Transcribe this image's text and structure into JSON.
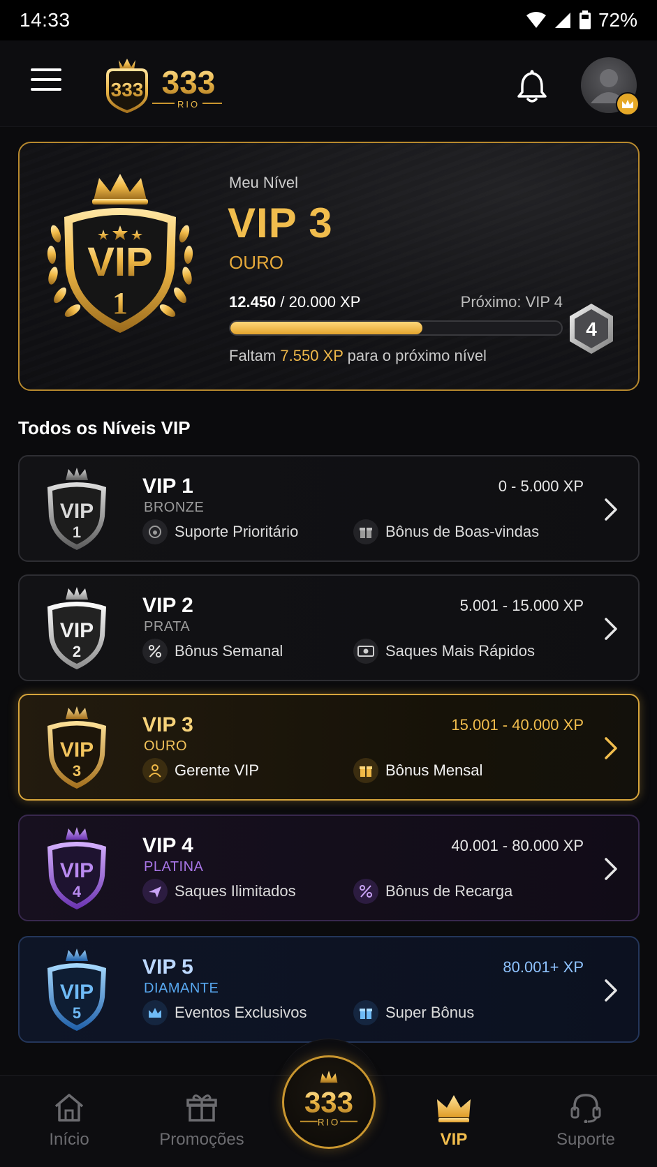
{
  "status": {
    "time": "14:33",
    "battery": "72%"
  },
  "header": {
    "logo_number": "333",
    "logo_sub": "RIO"
  },
  "my_level": {
    "heading": "Meu Nível",
    "level": "VIP 3",
    "tier": "OURO",
    "badge_text": "VIP",
    "badge_number": "1",
    "xp_current": "12.450",
    "xp_total": "/ 20.000 XP",
    "next_label": "Próximo: VIP 4",
    "next_number": "4",
    "progress_fraction": 0.58,
    "remaining_prefix": "Faltam",
    "remaining_value": "7.550 XP",
    "remaining_suffix": "para o próximo nível"
  },
  "section_title": "Todos os Níveis VIP",
  "tiers": [
    {
      "name": "VIP 1",
      "rank": "BRONZE",
      "range": "0 - 5.000 XP",
      "badge": "1",
      "perk1": "Suporte Prioritário",
      "perk2": "Bônus de Boas-vindas"
    },
    {
      "name": "VIP 2",
      "rank": "PRATA",
      "range": "5.001 - 15.000 XP",
      "badge": "2",
      "perk1": "Bônus Semanal",
      "perk2": "Saques Mais Rápidos"
    },
    {
      "name": "VIP 3",
      "rank": "OURO",
      "range": "15.001 - 40.000 XP",
      "badge": "3",
      "perk1": "Gerente VIP",
      "perk2": "Bônus Mensal"
    },
    {
      "name": "VIP 4",
      "rank": "PLATINA",
      "range": "40.001 - 80.000 XP",
      "badge": "4",
      "perk1": "Saques Ilimitados",
      "perk2": "Bônus de Recarga"
    },
    {
      "name": "VIP 5",
      "rank": "DIAMANTE",
      "range": "80.001+ XP",
      "badge": "5",
      "perk1": "Eventos Exclusivos",
      "perk2": "Super Bônus"
    }
  ],
  "nav": {
    "home": "Início",
    "promos": "Promoções",
    "center_number": "333",
    "center_sub": "RIO",
    "vip": "VIP",
    "support": "Suporte"
  },
  "colors": {
    "gold": "#f1bd4d",
    "purple": "#a875e6",
    "blue": "#58a8f0",
    "silver": "#c8c8c8"
  }
}
